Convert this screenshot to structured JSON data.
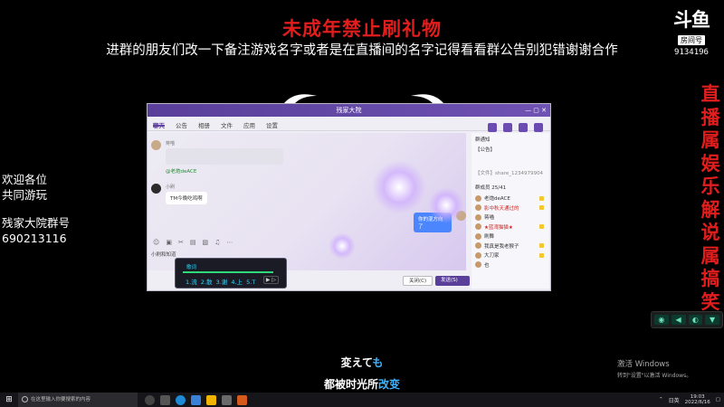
{
  "stream": {
    "banner_title": "未成年禁止刷礼物",
    "banner_subtitle": "进群的朋友们改一下备注游戏名字或者是在直播间的名字记得看看群公告别犯错谢谢合作",
    "logo_mark": "斗鱼",
    "logo_room_label": "房间号",
    "room_number": "9134196",
    "vertical_text": "直播属娱乐解说属搞笑",
    "left_notes": [
      "欢迎各位",
      "共同游玩",
      "残家大院群号",
      "690213116"
    ]
  },
  "qq": {
    "window_title": "残家大院",
    "tabs": [
      "聊天",
      "公告",
      "相册",
      "文件",
      "应用",
      "设置"
    ],
    "sender_1": "蒋喵",
    "mention_text": "@老炮deACE",
    "sender_2": "小刷",
    "bubble_text": "TM今晚吃鸡啊",
    "blue_bubble": "你的混方向了",
    "input_label": "小刷和知道",
    "close_button": "关闭(C)",
    "send_button": "发送(S)",
    "notice_label": "群通知",
    "notice_text": "【公告】",
    "file_text": "【文件】share_1234979904",
    "members_label": "群成员 25/41",
    "members": [
      {
        "name": "老炮deACE",
        "highlight": false
      },
      {
        "name": "影中秋天通过的",
        "highlight": true
      },
      {
        "name": "蒋喵",
        "highlight": false
      },
      {
        "name": "★蓝湾猫猫★",
        "highlight": true
      },
      {
        "name": "刷舞",
        "highlight": false
      },
      {
        "name": "我真是我老猴子",
        "highlight": false
      },
      {
        "name": "大刀家",
        "highlight": false
      },
      {
        "name": "也",
        "highlight": false
      }
    ]
  },
  "music": {
    "label": "歌词",
    "lyrics": [
      "1.流",
      "2.散",
      "3.谢",
      "4.上",
      "5.T"
    ],
    "controls": "▶ ▷"
  },
  "overlay_widget": [
    "◉",
    "◀",
    "◐",
    "▼"
  ],
  "lyrics_overlay": {
    "line1_main": "変えて",
    "line1_hl": "も",
    "line2_main": "都被时光所",
    "line2_hl": "改变"
  },
  "windows": {
    "activate_title": "激活 Windows",
    "activate_sub": "转到\"设置\"以激活 Windows。",
    "search_placeholder": "在这里输入你要搜索的内容",
    "ime": "日英",
    "time": "19:03",
    "date": "2022/6/16"
  },
  "colors": {
    "banner_red": "#e21d1d",
    "qq_purple": "#5a3f9a",
    "lyric_highlight": "#3fb3ff"
  }
}
